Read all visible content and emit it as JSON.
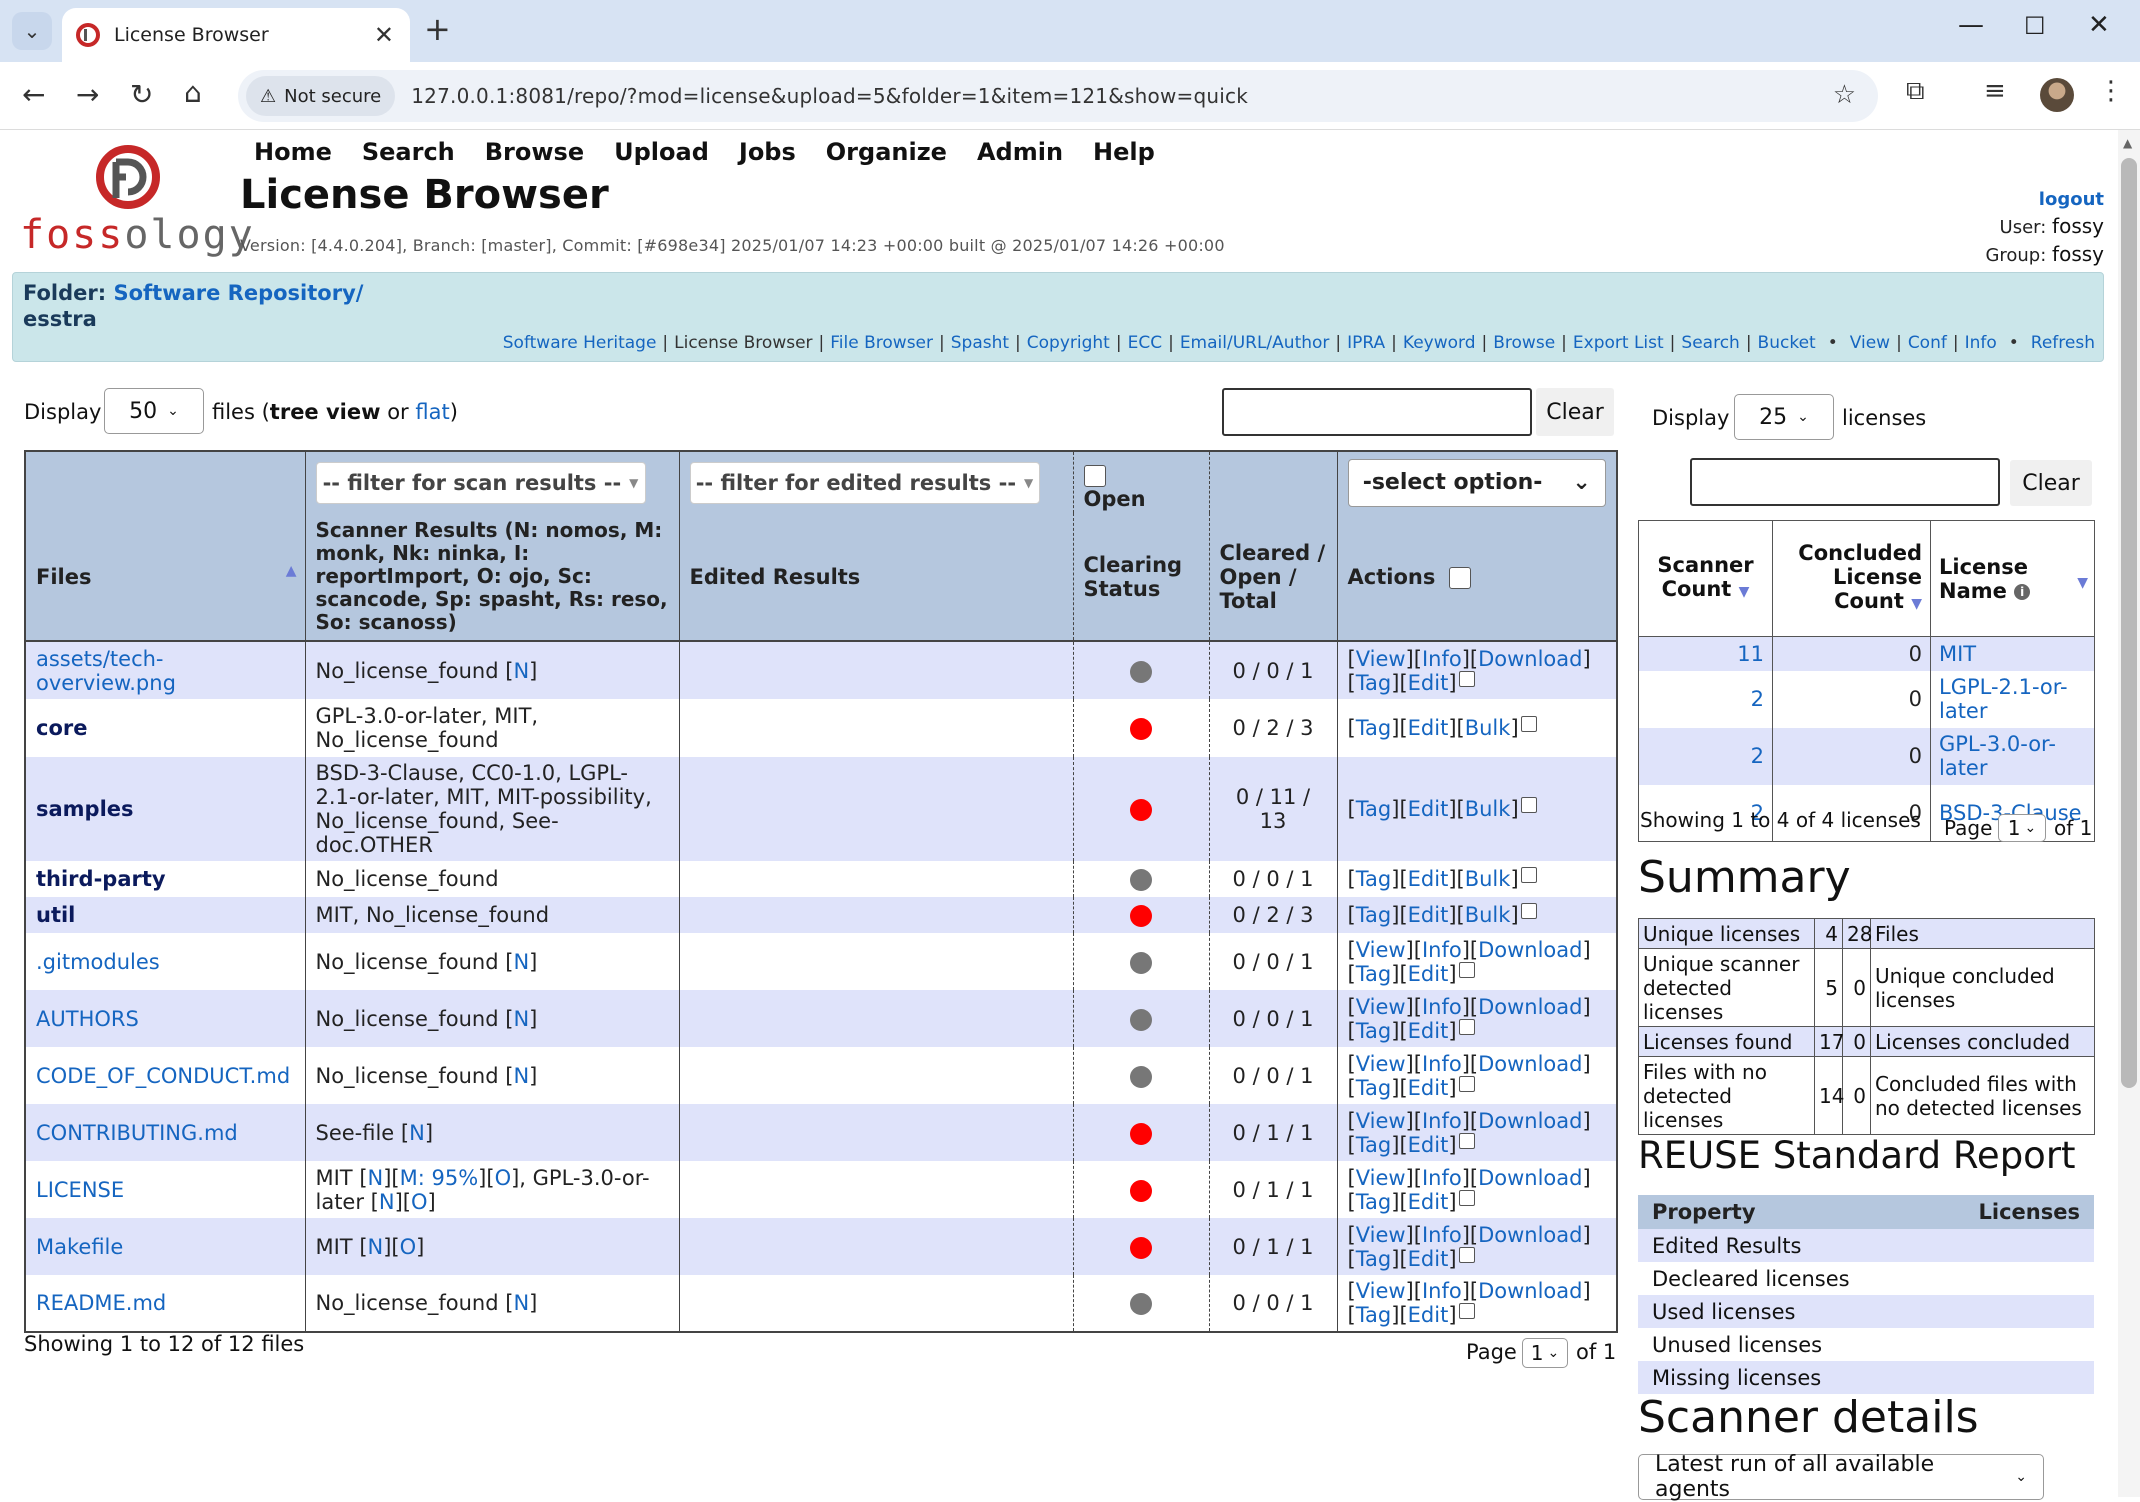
{
  "browser": {
    "tab_title": "License Browser",
    "security_label": "Not secure",
    "url": "127.0.0.1:8081/repo/?mod=license&upload=5&folder=1&item=121&show=quick"
  },
  "header": {
    "logo_text_red": "foss",
    "logo_text_grey": "ology",
    "menu": [
      "Home",
      "Search",
      "Browse",
      "Upload",
      "Jobs",
      "Organize",
      "Admin",
      "Help"
    ],
    "title": "License Browser",
    "version": "Version: [4.4.0.204], Branch: [master], Commit: [#698e34] 2025/01/07 14:23 +00:00 built @ 2025/01/07 14:26 +00:00",
    "logout": "logout",
    "user_label": "User:",
    "user": "fossy",
    "group_label": "Group:",
    "group": "fossy"
  },
  "folderbar": {
    "folder_label": "Folder:",
    "folder_link": "Software Repository/",
    "upload_name": "esstra",
    "links": [
      "Software Heritage",
      "License Browser",
      "File Browser",
      "Spasht",
      "Copyright",
      "ECC",
      "Email/URL/Author",
      "IPRA",
      "Keyword",
      "Browse",
      "Export List",
      "Search",
      "Bucket"
    ],
    "links2": [
      "View",
      "Conf",
      "Info"
    ],
    "refresh": "Refresh"
  },
  "files_panel": {
    "display_label": "Display",
    "display_value": "50",
    "files_label": "files (",
    "tree_view": "tree view",
    "or": " or ",
    "flat": "flat",
    "close_paren": ")",
    "clear": "Clear",
    "filter_scan": "-- filter for scan results --",
    "filter_edited": "-- filter for edited results --",
    "open_label": "Open",
    "select_option": "-select option-",
    "headers": {
      "files": "Files",
      "scanner": "Scanner Results (N: nomos, M: monk, Nk: ninka, I: reportImport, O: ojo, Sc: scancode, Sp: spasht, Rs: reso, So: scanoss)",
      "edited": "Edited Results",
      "clearing": "Clearing Status",
      "cleared": "Cleared / Open / Total",
      "actions": "Actions"
    },
    "rows": [
      {
        "name": "assets/tech-overview.png",
        "scan": "No_license_found",
        "scan_links": [
          "N"
        ],
        "status": "grey",
        "counts": "0 / 0 / 1"
      },
      {
        "name": "core",
        "scan": "GPL-3.0-or-later, MIT, No_license_found",
        "scan_links": [],
        "status": "red",
        "counts": "0 / 2 / 3"
      },
      {
        "name": "samples",
        "scan": "BSD-3-Clause, CC0-1.0, LGPL-2.1-or-later, MIT, MIT-possibility, No_license_found, See-doc.OTHER",
        "scan_links": [],
        "status": "red",
        "counts": "0 / 11 / 13"
      },
      {
        "name": "third-party",
        "scan": "No_license_found",
        "scan_links": [],
        "status": "grey",
        "counts": "0 / 0 / 1"
      },
      {
        "name": "util",
        "scan": "MIT, No_license_found",
        "scan_links": [],
        "status": "red",
        "counts": "0 / 2 / 3"
      },
      {
        "name": ".gitmodules",
        "scan": "No_license_found",
        "scan_links": [
          "N"
        ],
        "status": "grey",
        "counts": "0 / 0 / 1"
      },
      {
        "name": "AUTHORS",
        "scan": "No_license_found",
        "scan_links": [
          "N"
        ],
        "status": "grey",
        "counts": "0 / 0 / 1"
      },
      {
        "name": "CODE_OF_CONDUCT.md",
        "scan": "No_license_found",
        "scan_links": [
          "N"
        ],
        "status": "grey",
        "counts": "0 / 0 / 1"
      },
      {
        "name": "CONTRIBUTING.md",
        "scan": "See-file",
        "scan_links": [
          "N"
        ],
        "status": "red",
        "counts": "0 / 1 / 1"
      },
      {
        "name": "LICENSE",
        "scan_a": "MIT",
        "scan_b": "M: 95%",
        "scan_c": ", GPL-3.0-or-later",
        "status": "red",
        "counts": "0 / 1 / 1"
      },
      {
        "name": "Makefile",
        "scan": "MIT",
        "scan_links": [
          "N",
          "O"
        ],
        "status": "red",
        "counts": "0 / 1 / 1"
      },
      {
        "name": "README.md",
        "scan": "No_license_found",
        "scan_links": [
          "N"
        ],
        "status": "grey",
        "counts": "0 / 0 / 1"
      }
    ],
    "actions": {
      "view": "View",
      "info": "Info",
      "download": "Download",
      "tag": "Tag",
      "edit": "Edit",
      "bulk": "Bulk"
    },
    "link_n": "N",
    "link_m": "M",
    "link_o": "O",
    "showing": "Showing 1 to 12 of 12 files",
    "page_label": "Page",
    "page_value": "1",
    "of_label": "of 1"
  },
  "licenses_panel": {
    "display_label": "Display",
    "display_value": "25",
    "licenses_label": "licenses",
    "clear": "Clear",
    "headers": {
      "scanner_count": "Scanner Count",
      "concluded": "Concluded License Count",
      "name": "License Name"
    },
    "rows": [
      {
        "scanner": "11",
        "concluded": "0",
        "name": "MIT"
      },
      {
        "scanner": "2",
        "concluded": "0",
        "name": "LGPL-2.1-or-later"
      },
      {
        "scanner": "2",
        "concluded": "0",
        "name": "GPL-3.0-or-later"
      },
      {
        "scanner": "2",
        "concluded": "0",
        "name": "BSD-3-Clause"
      }
    ],
    "showing": "Showing 1 to 4 of 4 licenses",
    "page_label": "Page",
    "page_value": "1",
    "of_label": "of 1"
  },
  "summary": {
    "title": "Summary",
    "rows": [
      {
        "l": "Unique licenses",
        "lv": "4",
        "rv": "28",
        "r": "Files"
      },
      {
        "l": "Unique scanner detected licenses",
        "lv": "5",
        "rv": "0",
        "r": "Unique concluded licenses"
      },
      {
        "l": "Licenses found",
        "lv": "17",
        "rv": "0",
        "r": "Licenses concluded"
      },
      {
        "l": "Files with no detected licenses",
        "lv": "14",
        "rv": "0",
        "r": "Concluded files with no detected licenses"
      }
    ]
  },
  "reuse": {
    "title": "REUSE Standard Report",
    "col_property": "Property",
    "col_licenses": "Licenses",
    "rows": [
      "Edited Results",
      "Decleared licenses",
      "Used licenses",
      "Unused licenses",
      "Missing licenses"
    ]
  },
  "scanner_details": {
    "title": "Scanner details",
    "select": "Latest run of all available agents"
  }
}
